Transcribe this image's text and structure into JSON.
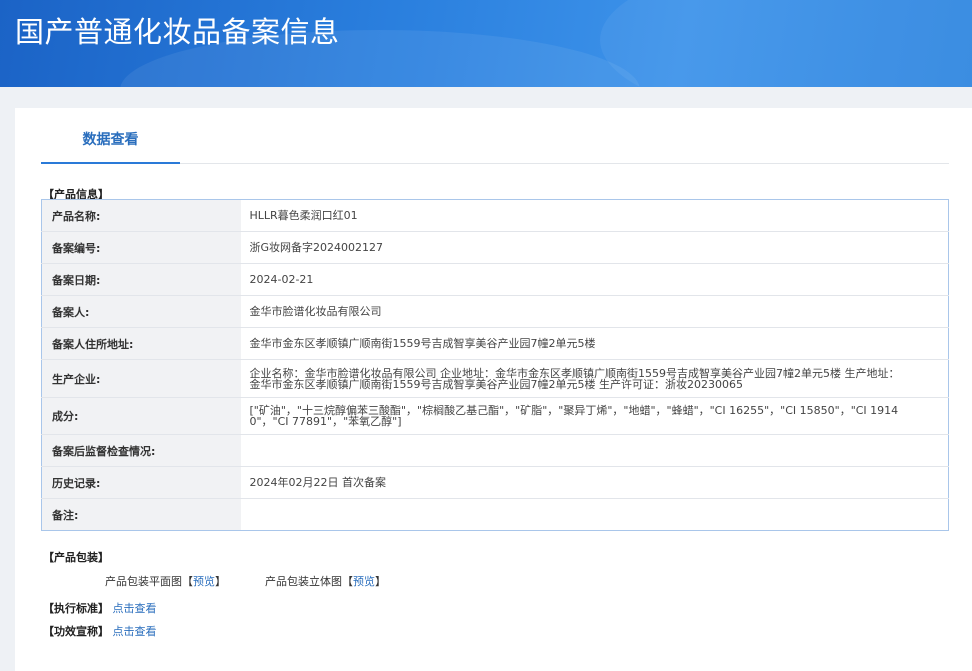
{
  "header": {
    "title": "国产普通化妆品备案信息"
  },
  "tabs": [
    {
      "label": "数据查看",
      "active": true
    }
  ],
  "product_info": {
    "section_label": "【产品信息】",
    "rows": [
      {
        "key": "产品名称:",
        "value": "HLLR暮色柔润口红01"
      },
      {
        "key": "备案编号:",
        "value": "浙G妆网备字2024002127"
      },
      {
        "key": "备案日期:",
        "value": "2024-02-21"
      },
      {
        "key": "备案人:",
        "value": "金华市脸谱化妆品有限公司"
      },
      {
        "key": "备案人住所地址:",
        "value": "金华市金东区孝顺镇广顺南街1559号吉成智享美谷产业园7幢2单元5楼"
      },
      {
        "key": "生产企业:",
        "value": "企业名称：金华市脸谱化妆品有限公司 企业地址：金华市金东区孝顺镇广顺南街1559号吉成智享美谷产业园7幢2单元5楼 生产地址：金华市金东区孝顺镇广顺南街1559号吉成智享美谷产业园7幢2单元5楼 生产许可证：浙妆20230065"
      },
      {
        "key": "成分:",
        "value": "[\"矿油\"，\"十三烷醇偏苯三酸酯\"，\"棕榈酸乙基己酯\"，\"矿脂\"，\"聚异丁烯\"，\"地蜡\"，\"蜂蜡\"，\"CI 16255\"，\"CI 15850\"，\"CI 19140\"，\"CI 77891\"，\"苯氧乙醇\"]"
      },
      {
        "key": "备案后监督检查情况:",
        "value": ""
      },
      {
        "key": "历史记录:",
        "value": "2024年02月22日 首次备案"
      },
      {
        "key": "备注:",
        "value": ""
      }
    ]
  },
  "packaging": {
    "section_label": "【产品包装】",
    "flat_label": "产品包装平面图",
    "solid_label": "产品包装立体图",
    "open_bracket": "【",
    "close_bracket": "】",
    "preview_link": "预览"
  },
  "standard": {
    "label": "【执行标准】",
    "link": "点击查看"
  },
  "efficacy": {
    "label": "【功效宣称】",
    "link": "点击查看"
  }
}
